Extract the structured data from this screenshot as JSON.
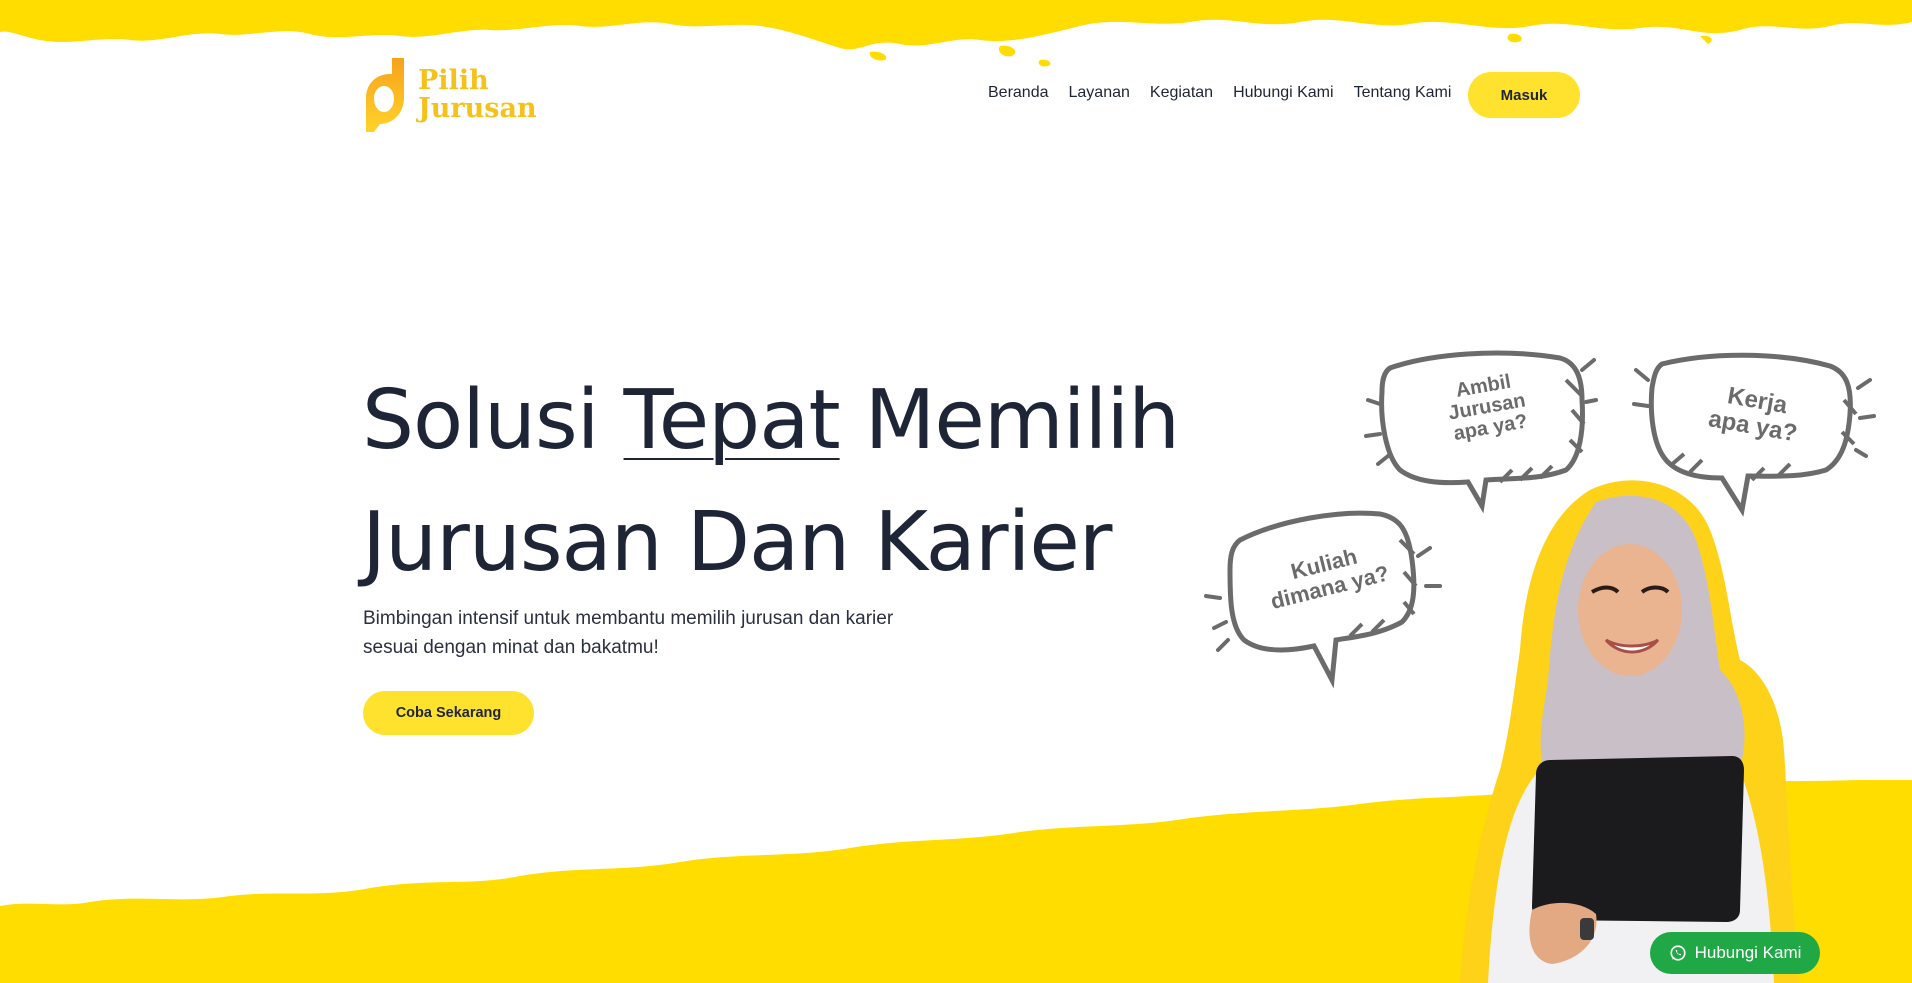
{
  "brand": {
    "line1": "Pilih",
    "line2": "Jurusan",
    "accent": "#f4c21b",
    "splash_color": "#ffdd00"
  },
  "nav": {
    "items": [
      "Beranda",
      "Layanan",
      "Kegiatan",
      "Hubungi Kami",
      "Tentang Kami"
    ],
    "login_label": "Masuk"
  },
  "hero": {
    "title_part1": "Solusi ",
    "title_highlight": "Tepat",
    "title_part2": " Memilih",
    "title_line2": "Jurusan Dan Karier",
    "subtitle_line1": "Bimbingan intensif untuk membantu memilih jurusan dan karier",
    "subtitle_line2": "sesuai dengan minat dan bakatmu!",
    "cta_label": "Coba Sekarang"
  },
  "bubbles": {
    "b1": [
      "Ambil",
      "Jurusan",
      "apa ya?"
    ],
    "b2": [
      "Kerja",
      "apa ya?"
    ],
    "b3": [
      "Kuliah",
      "dimana ya?"
    ]
  },
  "whatsapp": {
    "label": "Hubungi Kami",
    "icon": "whatsapp-icon",
    "color": "#21a846"
  },
  "colors": {
    "primary_button": "#ffe22d",
    "text_dark": "#1e2536"
  }
}
